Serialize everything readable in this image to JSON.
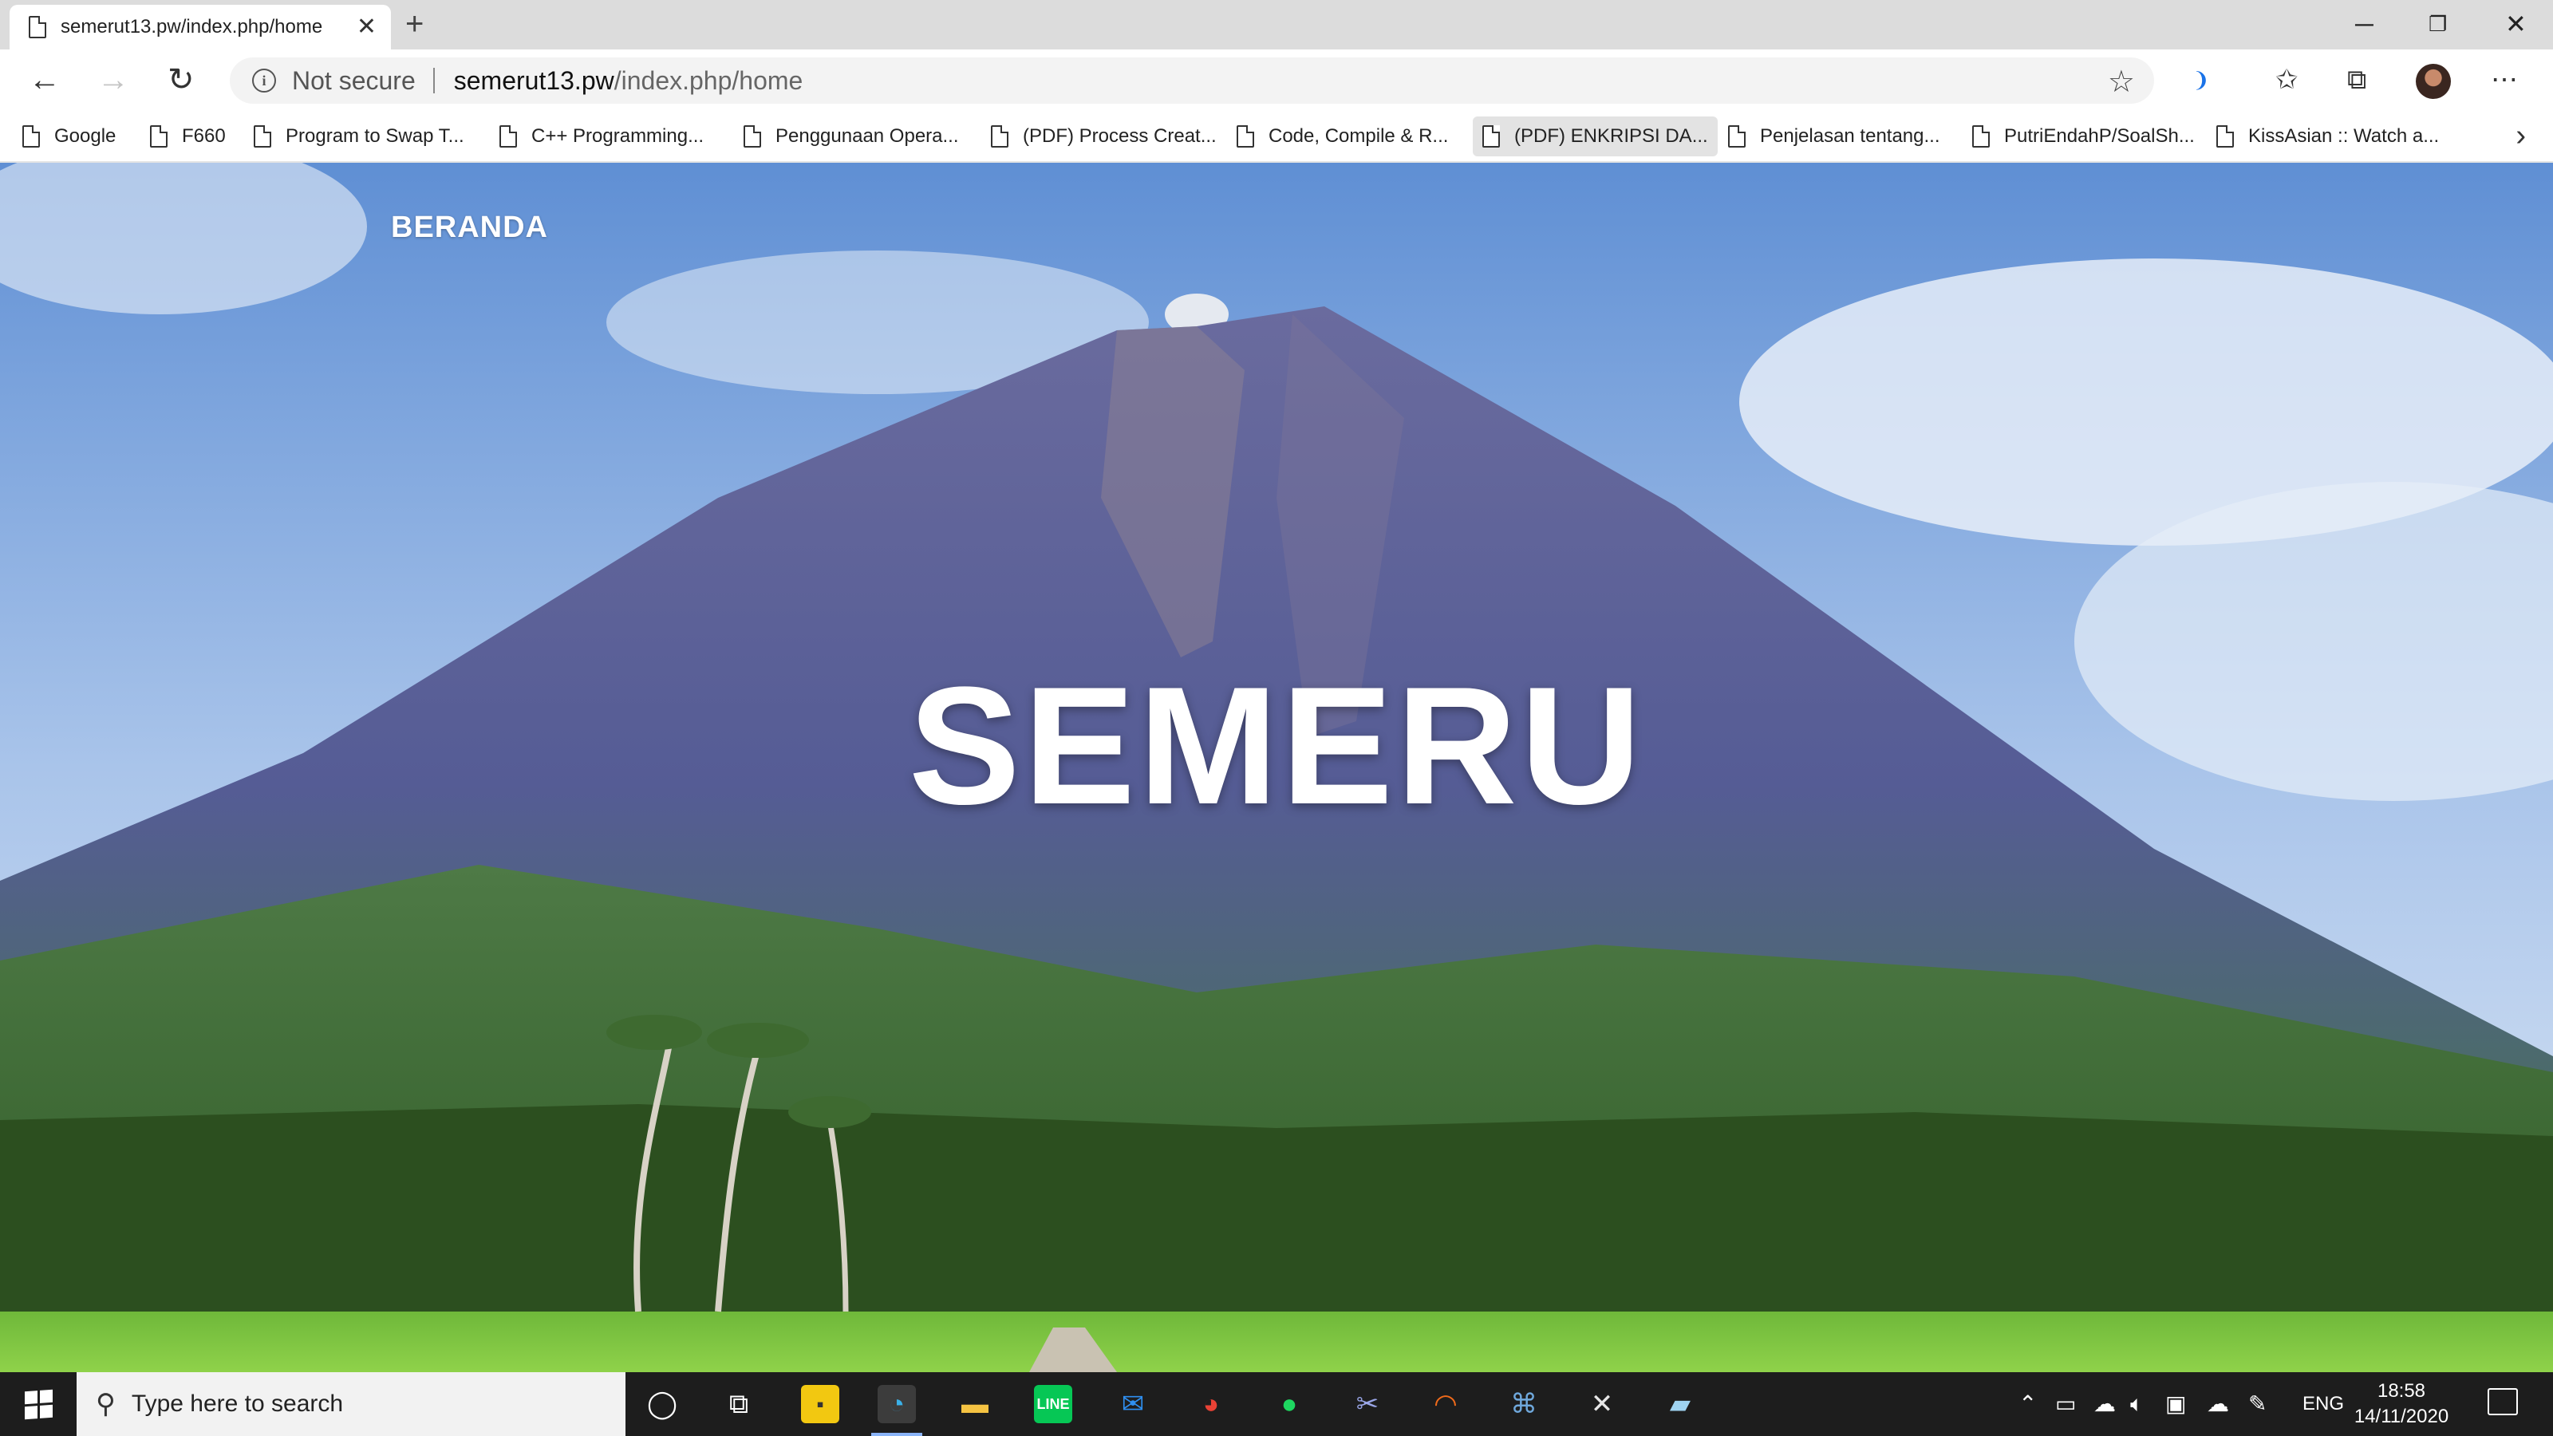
{
  "browser": {
    "tab": {
      "title": "semerut13.pw/index.php/home"
    },
    "address_bar": {
      "security_label": "Not secure",
      "url_domain": "semerut13.pw",
      "url_path": "/index.php/home"
    },
    "favorites": [
      {
        "label": "Google"
      },
      {
        "label": "F660"
      },
      {
        "label": "Program to Swap T..."
      },
      {
        "label": "C++ Programming..."
      },
      {
        "label": "Penggunaan Opera..."
      },
      {
        "label": "(PDF) Process Creat..."
      },
      {
        "label": "Code, Compile & R..."
      },
      {
        "label": "(PDF) ENKRIPSI DA..."
      },
      {
        "label": "Penjelasan tentang..."
      },
      {
        "label": "PutriEndahP/SoalSh..."
      },
      {
        "label": "KissAsian :: Watch a..."
      }
    ]
  },
  "page": {
    "nav": {
      "home_label": "BERANDA"
    },
    "hero": {
      "title": "SEMERU"
    }
  },
  "taskbar": {
    "search_placeholder": "Type here to search",
    "language": "ENG",
    "time": "18:58",
    "date": "14/11/2020"
  }
}
